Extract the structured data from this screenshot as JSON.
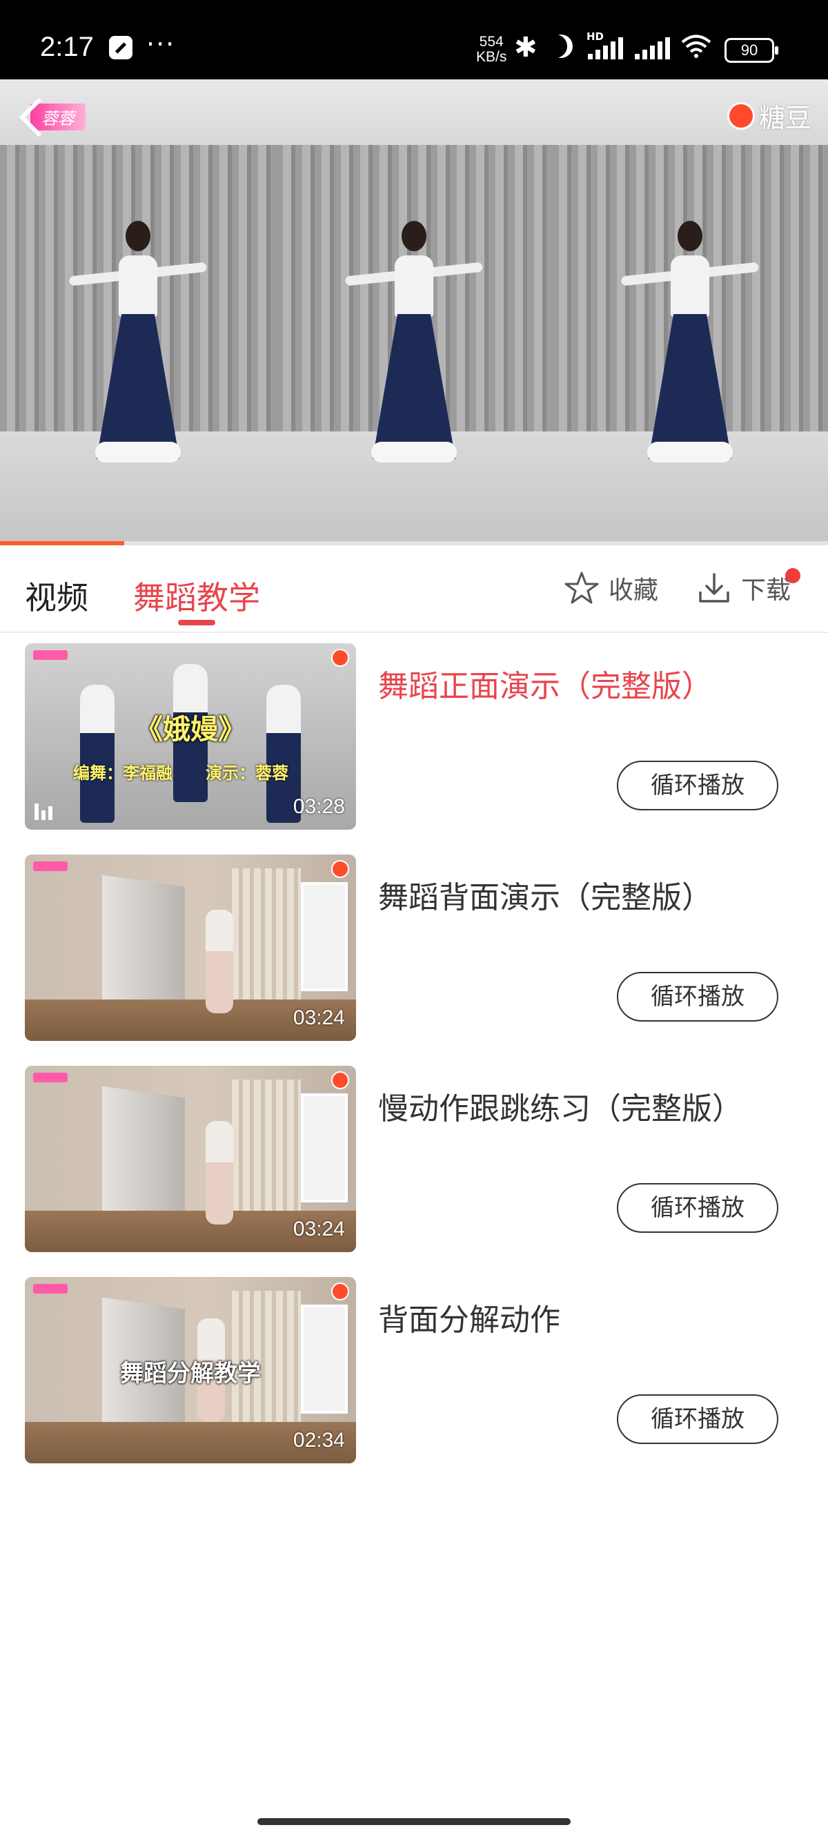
{
  "status_bar": {
    "time": "2:17",
    "more": "···",
    "net_speed_value": "554",
    "net_speed_unit": "KB/s",
    "hd": "HD",
    "battery": "90",
    "icons": [
      "wrench-icon",
      "bluetooth-icon",
      "moon-icon",
      "signal-icon",
      "signal-icon",
      "wifi-icon",
      "battery-icon"
    ]
  },
  "player": {
    "badge": "蓉蓉",
    "logo_text": "糖豆",
    "progress_fraction": 0.15,
    "accent_color": "#ff5a2a"
  },
  "tabs": {
    "video": "视频",
    "dance": "舞蹈教学",
    "active_color": "#e8454d",
    "collect": "收藏",
    "download": "下载"
  },
  "videos": [
    {
      "title": "舞蹈正面演示（完整版）",
      "duration": "03:28",
      "caption": "《娥嫚》",
      "sub": "编舞：李福融　　演示：蓉蓉",
      "loop_label": "循环播放",
      "playing": true
    },
    {
      "title": "舞蹈背面演示（完整版）",
      "duration": "03:24",
      "caption": "",
      "loop_label": "循环播放",
      "playing": false
    },
    {
      "title": "慢动作跟跳练习（完整版）",
      "duration": "03:24",
      "caption": "",
      "loop_label": "循环播放",
      "playing": false
    },
    {
      "title": "背面分解动作",
      "duration": "02:34",
      "caption": "舞蹈分解教学",
      "loop_label": "循环播放",
      "playing": false
    }
  ]
}
